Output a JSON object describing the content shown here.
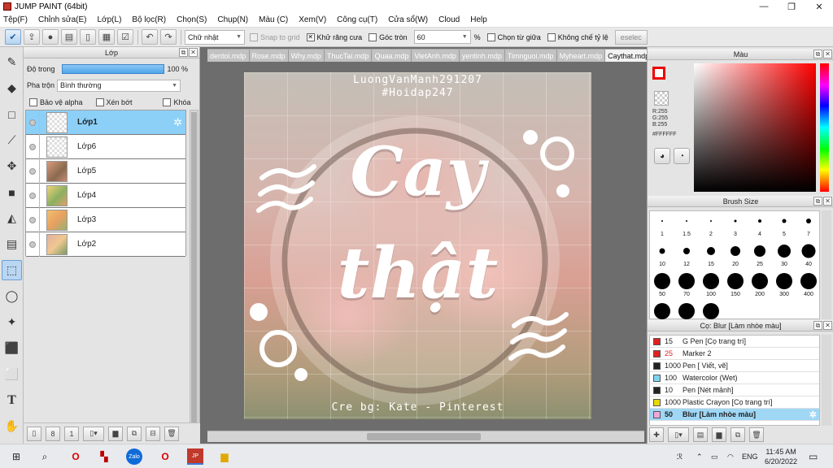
{
  "window": {
    "title": "JUMP PAINT (64bit)",
    "min": "—",
    "max": "❐",
    "close": "✕"
  },
  "menu": [
    "Tệp(F)",
    "Chỉnh sửa(E)",
    "Lớp(L)",
    "Bộ lọc(R)",
    "Chọn(S)",
    "Chụp(N)",
    "Màu (C)",
    "Xem(V)",
    "Công cụ(T)",
    "Cửa sổ(W)",
    "Cloud",
    "Help"
  ],
  "toolbar": {
    "shape_select": "Chữ nhật",
    "snap_grid": "Snap to grid",
    "antialias": "Khử răng cưa",
    "antialias_checked": "✕",
    "rounded": "Góc tròn",
    "rounded_value": "60",
    "percent": "%",
    "from_center": "Chọn từ giữa",
    "no_ratio": "Không chế tỷ lệ",
    "deselect": "eselec"
  },
  "layer_panel": {
    "title": "Lớp",
    "opacity_label": "Độ trong",
    "opacity_value": "100 %",
    "opacity_fraction": 1.0,
    "blend_label": "Pha trộn",
    "blend_value": "Bình thường",
    "protect_alpha": "Bảo vệ alpha",
    "clipping": "Xén bớt",
    "lock": "Khóa",
    "layers": [
      {
        "name": "Lớp1",
        "selected": true
      },
      {
        "name": "Lớp6",
        "selected": false
      },
      {
        "name": "Lớp5",
        "selected": false
      },
      {
        "name": "Lớp4",
        "selected": false
      },
      {
        "name": "Lớp3",
        "selected": false
      },
      {
        "name": "Lớp2",
        "selected": false
      }
    ]
  },
  "doc_tabs": [
    "dentoi.mdp",
    "Rose.mdp",
    "Why.mdp",
    "ThucTai.mdp",
    "Quaa.mdp",
    "VietAnh.mdp",
    "yentinh.mdp",
    "Timnguoi.mdp",
    "Myheart.mdp",
    "Caythat.mdp"
  ],
  "canvas": {
    "watermark1": "LuongVanManh291207",
    "watermark2": "#Hoidap247",
    "main_line1": "Cay",
    "main_line2": "thật",
    "credit": "Cre bg: Kate - Pinterest"
  },
  "color_panel": {
    "title": "Màu",
    "r": "R:255",
    "g": "G:255",
    "b": "B:255",
    "hex": "#FFFFFF",
    "primary_color": "#ff0000",
    "secondary_color": "#ffffff"
  },
  "brush_size": {
    "title": "Brush Size",
    "sizes": [
      "1",
      "1.5",
      "2",
      "3",
      "4",
      "5",
      "7",
      "10",
      "12",
      "15",
      "20",
      "25",
      "30",
      "40",
      "50",
      "70",
      "100",
      "150",
      "200",
      "300",
      "400",
      "",
      "",
      ""
    ]
  },
  "brush_list": {
    "title": "Cọ: Blur [Làm nhòe màu]",
    "items": [
      {
        "size": "15",
        "name": "G Pen [Cọ trang trí]",
        "color": "#e02020",
        "size_color": "#222"
      },
      {
        "size": "25",
        "name": "Marker 2",
        "color": "#e02020",
        "size_color": "#e02020"
      },
      {
        "size": "1000",
        "name": "Pen [ Viết, vẽ]",
        "color": "#222222",
        "size_color": "#222"
      },
      {
        "size": "100",
        "name": "Watercolor (Wet)",
        "color": "#7dd3f0",
        "size_color": "#222"
      },
      {
        "size": "10",
        "name": "Pen [Nét mảnh]",
        "color": "#222222",
        "size_color": "#222"
      },
      {
        "size": "1000",
        "name": "Plastic Crayon [Cọ trang trí]",
        "color": "#e8d800",
        "size_color": "#222"
      },
      {
        "size": "50",
        "name": "Blur [Làm nhòe màu]",
        "color": "#f0a8d8",
        "size_color": "#222",
        "selected": true
      }
    ]
  },
  "taskbar": {
    "lang": "ENG",
    "time": "11:45 AM",
    "date": "6/20/2022"
  }
}
